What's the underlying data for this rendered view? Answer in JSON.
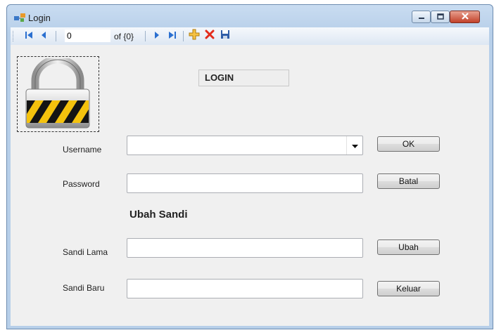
{
  "window": {
    "title": "Login"
  },
  "navigator": {
    "position": "0",
    "count_label": "of {0}"
  },
  "header": {
    "label": "LOGIN"
  },
  "form": {
    "username_label": "Username",
    "password_label": "Password",
    "section_title": "Ubah Sandi",
    "old_password_label": "Sandi Lama",
    "new_password_label": "Sandi Baru"
  },
  "buttons": {
    "ok": "OK",
    "cancel": "Batal",
    "change": "Ubah",
    "exit": "Keluar"
  },
  "icons": [
    "app-icon",
    "move-first-icon",
    "move-previous-icon",
    "move-next-icon",
    "move-last-icon",
    "add-new-icon",
    "delete-icon",
    "save-icon",
    "dropdown-arrow-icon",
    "padlock-icon",
    "minimize-icon",
    "maximize-icon",
    "close-icon"
  ],
  "colors": {
    "title_bar": "#b7cfe9",
    "close_button": "#c2412a",
    "client_bg": "#f0f0f0"
  }
}
